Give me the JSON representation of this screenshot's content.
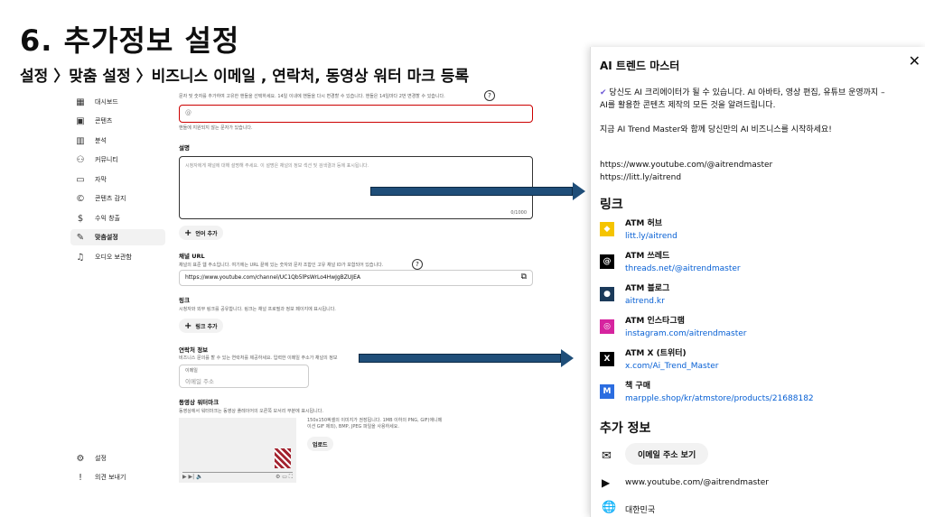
{
  "slide": {
    "title": "6. 추가정보 설정",
    "breadcrumb": "설정 〉맞춤 설정 〉비즈니스 이메일 , 연락처, 동영상 워터 마크 등록"
  },
  "sidebar": {
    "items": [
      {
        "label": "대시보드",
        "icon": "dashboard-icon",
        "glyph": "▦"
      },
      {
        "label": "콘텐츠",
        "icon": "content-icon",
        "glyph": "▣"
      },
      {
        "label": "분석",
        "icon": "analytics-icon",
        "glyph": "▥"
      },
      {
        "label": "커뮤니티",
        "icon": "community-icon",
        "glyph": "⚇"
      },
      {
        "label": "자막",
        "icon": "subtitles-icon",
        "glyph": "▭"
      },
      {
        "label": "콘텐츠 감지",
        "icon": "copyright-icon",
        "glyph": "©"
      },
      {
        "label": "수익 창출",
        "icon": "earn-icon",
        "glyph": "$"
      },
      {
        "label": "맞춤설정",
        "icon": "customization-icon",
        "glyph": "✎"
      },
      {
        "label": "오디오 보관함",
        "icon": "audio-library-icon",
        "glyph": "♫"
      }
    ],
    "settings_label": "설정",
    "feedback_label": "의견 보내기"
  },
  "main": {
    "handle_desc": "문자 및 숫자를 추가하여 고유한 핸들을 선택하세요. 14일 이내에 핸들을 다시 변경할 수 있습니다. 핸들은 14일마다 2번 변경할 수 있습니다.",
    "handle_value": "@",
    "handle_error": "핸들에 지원되지 않는 문자가 있습니다.",
    "description_label": "설명",
    "description_placeholder": "시청자에게 채널에 대해 설명해 주세요. 이 설명은 채널의 정보 섹션 및 검색결과 등에 표시됩니다.",
    "description_count": "0/1000",
    "add_language_label": "언어 추가",
    "channel_url_label": "채널 URL",
    "channel_url_desc": "채널의 표준 웹 주소입니다. 여기에는 URL 끝에 있는 숫자와 문자 조합인 고유 채널 ID가 포함되어 있습니다.",
    "channel_url_value": "https://www.youtube.com/channel/UC1Qb5lPsWrLo4HwJgBZUJEA",
    "links_label": "링크",
    "links_desc": "시청자와 외부 링크를 공유합니다. 링크는 채널 프로필과 정보 페이지에 표시됩니다.",
    "add_link_label": "링크 추가",
    "contact_label": "연락처 정보",
    "contact_desc": "비즈니스 문의를 할 수 있는 연락처를 제공하세요. 입력한 이메일 주소가 채널의 정보",
    "email_field_label": "이메일",
    "email_placeholder": "이메일 주소",
    "watermark_label": "동영상 워터마크",
    "watermark_desc": "동영상에서 워터마크는 동영상 플레이어의 오른쪽 모서리 부분에 표시됩니다.",
    "watermark_spec": "150x150픽셀의 이미지가 권장됩니다. 1MB 이하의 PNG, GIF(애니메이션 GIF 제외), BMP, JPEG 파일을 사용하세요.",
    "upload_label": "업로드"
  },
  "panel": {
    "title": "AI 트렌드 마스터",
    "intro1": "당신도 AI 크리에이터가 될 수 있습니다. AI 아바타, 영상 편집, 유튜브 운영까지 –",
    "intro2": "AI를 활용한 콘텐츠 제작의 모든 것을 알려드립니다.",
    "intro3": "지금 AI Trend Master와 함께 당신만의 AI 비즈니스를 시작하세요!",
    "url1": "https://www.youtube.com/@aitrendmaster",
    "url2": "https://litt.ly/aitrend",
    "links_heading": "링크",
    "links": [
      {
        "title": "ATM 허브",
        "url": "litt.ly/aitrend",
        "icon": "littly-icon",
        "color": "#f5c400",
        "glyph": "◆"
      },
      {
        "title": "ATM 쓰레드",
        "url": "threads.net/@aitrendmaster",
        "icon": "threads-icon",
        "color": "#000000",
        "glyph": "@"
      },
      {
        "title": "ATM 블로그",
        "url": "aitrend.kr",
        "icon": "blog-icon",
        "color": "#1b3a5a",
        "glyph": "●"
      },
      {
        "title": "ATM 인스타그램",
        "url": "instagram.com/aitrendmaster",
        "icon": "instagram-icon",
        "color": "#d6249f",
        "glyph": "◎"
      },
      {
        "title": "ATM X (트위터)",
        "url": "x.com/Ai_Trend_Master",
        "icon": "x-icon",
        "color": "#000000",
        "glyph": "X"
      },
      {
        "title": "책 구매",
        "url": "marpple.shop/kr/atmstore/products/21688182",
        "icon": "marpple-icon",
        "color": "#2b6de0",
        "glyph": "M"
      }
    ],
    "extra_heading": "추가 정보",
    "email_button": "이메일 주소 보기",
    "channel_url": "www.youtube.com/@aitrendmaster",
    "country": "대한민국"
  },
  "colors": {
    "arrow": "#1f4e79",
    "link": "#065fd4",
    "error": "#cc0000",
    "verified": "#6f5bd6"
  }
}
